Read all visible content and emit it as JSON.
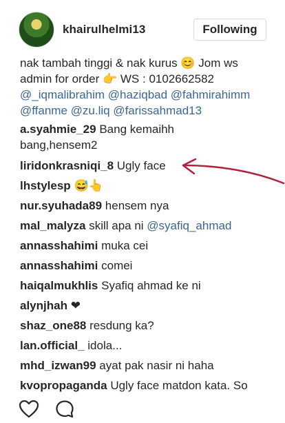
{
  "header": {
    "username": "khairulhelmi13",
    "follow_label": "Following"
  },
  "caption": {
    "line1": "nak tambah tinggi & nak kurus 😊 Jom ws",
    "line2": "admin for order 👉 WS : 0102662582",
    "mentions_line3": "@_iqmalibrahim @haziqbad @fahmirahimm",
    "mentions_line4": "@ffanme @zu.liq @farissahmad13"
  },
  "comments": [
    {
      "user": "a.syahmie_29",
      "text": "Bang kemaihh bang,hensem2"
    },
    {
      "user": "liridonkrasniqi_8",
      "text": "Ugly face"
    },
    {
      "user": "lhstylesp",
      "text": "😅👆"
    },
    {
      "user": "nur.syuhada89",
      "text": "hensem nya"
    },
    {
      "user": "mal_malyza",
      "text": "skill apa ni",
      "mention": "@syafiq_ahmad"
    },
    {
      "user": "annasshahimi",
      "text": "muka cei"
    },
    {
      "user": "annasshahimi",
      "text": "comei"
    },
    {
      "user": "haiqalmukhlis",
      "text": "Syafiq ahmad ke ni"
    },
    {
      "user": "alynjhah",
      "text": "❤"
    },
    {
      "user": "shaz_one88",
      "text": "resdung ka?"
    },
    {
      "user": "lan.official_",
      "text": "idola..."
    },
    {
      "user": "mhd_izwan99",
      "text": "ayat pak nasir ni haha"
    },
    {
      "user": "kvopropaganda",
      "text": "Ugly face matdon kata. So"
    }
  ],
  "footer": {
    "like_icon": "heart-icon",
    "comment_icon": "comment-icon"
  },
  "colors": {
    "mention": "#3b6694",
    "annotation_arrow": "#b0213f"
  }
}
